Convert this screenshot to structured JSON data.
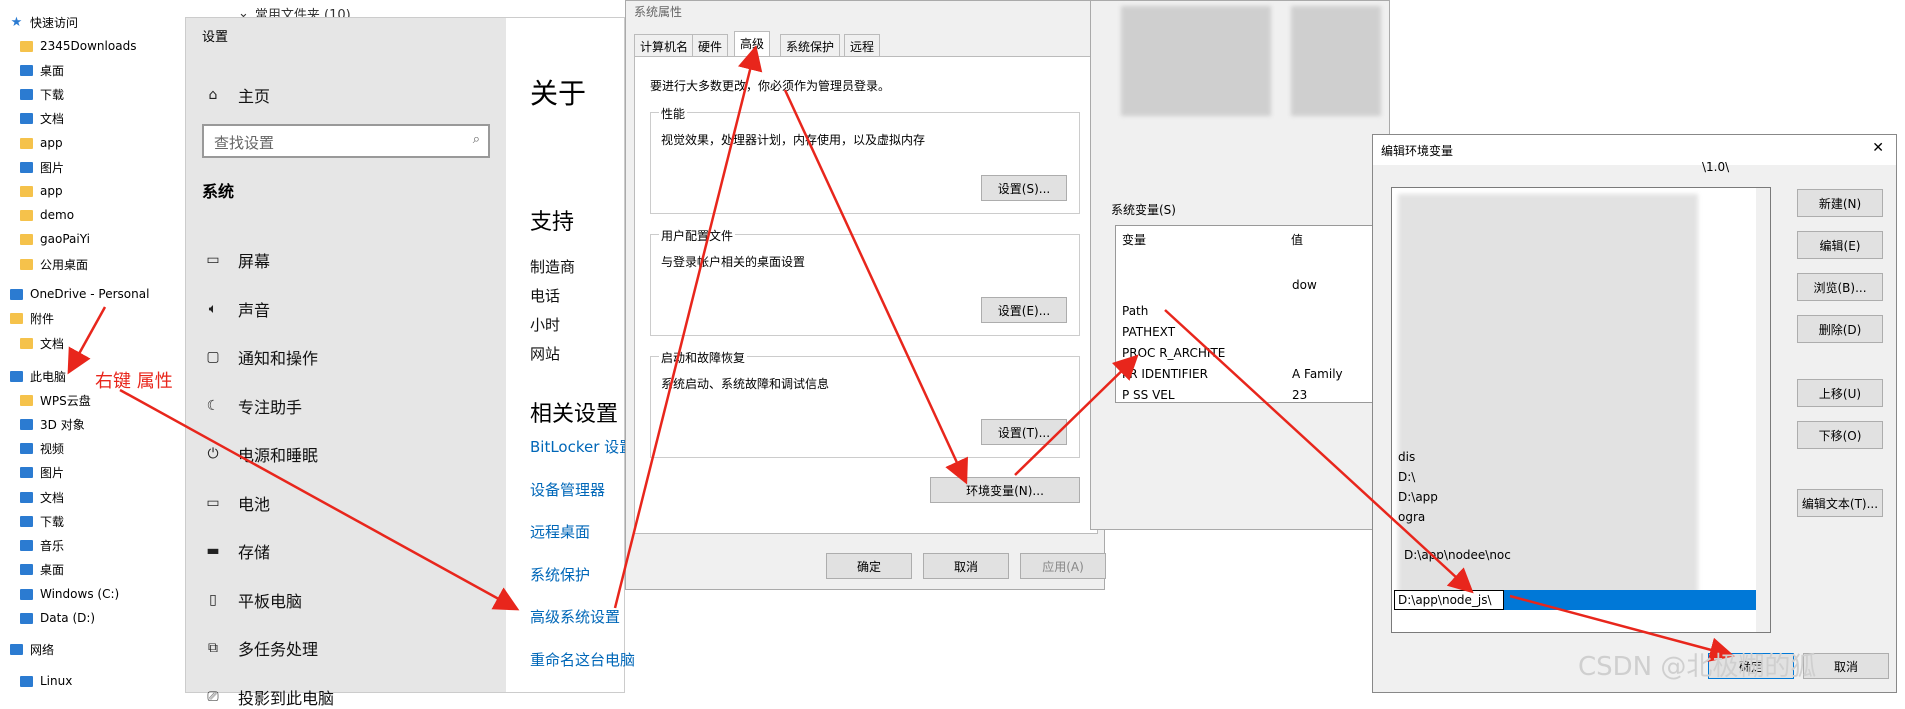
{
  "explorer": {
    "folder_header": "常用文件夹 (10)",
    "items": [
      {
        "label": "快速访问",
        "icon": "star-icon"
      },
      {
        "label": "2345Downloads",
        "icon": "folder-icon"
      },
      {
        "label": "桌面",
        "icon": "desktop-icon"
      },
      {
        "label": "下载",
        "icon": "download-icon"
      },
      {
        "label": "文档",
        "icon": "document-icon"
      },
      {
        "label": "app",
        "icon": "folder-icon"
      },
      {
        "label": "图片",
        "icon": "pictures-icon"
      },
      {
        "label": "app",
        "icon": "folder-icon"
      },
      {
        "label": "demo",
        "icon": "folder-icon"
      },
      {
        "label": "gaoPaiYi",
        "icon": "folder-icon"
      },
      {
        "label": "公用桌面",
        "icon": "folder-icon"
      },
      {
        "label": "OneDrive - Personal",
        "icon": "cloud-icon"
      },
      {
        "label": "附件",
        "icon": "folder-icon"
      },
      {
        "label": "文档",
        "icon": "folder-icon"
      },
      {
        "label": "此电脑",
        "icon": "computer-icon"
      },
      {
        "label": "WPS云盘",
        "icon": "folder-icon"
      },
      {
        "label": "3D 对象",
        "icon": "cube-icon"
      },
      {
        "label": "视频",
        "icon": "video-icon"
      },
      {
        "label": "图片",
        "icon": "pictures-icon"
      },
      {
        "label": "文档",
        "icon": "document-icon"
      },
      {
        "label": "下载",
        "icon": "download-icon"
      },
      {
        "label": "音乐",
        "icon": "music-icon"
      },
      {
        "label": "桌面",
        "icon": "desktop-icon"
      },
      {
        "label": "Windows (C:)",
        "icon": "drive-icon"
      },
      {
        "label": "Data (D:)",
        "icon": "drive-icon"
      },
      {
        "label": "网络",
        "icon": "network-icon"
      },
      {
        "label": "Linux",
        "icon": "linux-icon"
      }
    ],
    "annotation": "右键 属性"
  },
  "settings": {
    "title": "设置",
    "home": "主页",
    "search_placeholder": "查找设置",
    "section": "系统",
    "nav": [
      {
        "label": "屏幕",
        "icon": "display-icon"
      },
      {
        "label": "声音",
        "icon": "sound-icon"
      },
      {
        "label": "通知和操作",
        "icon": "notification-icon"
      },
      {
        "label": "专注助手",
        "icon": "moon-icon"
      },
      {
        "label": "电源和睡眠",
        "icon": "power-icon"
      },
      {
        "label": "电池",
        "icon": "battery-icon"
      },
      {
        "label": "存储",
        "icon": "storage-icon"
      },
      {
        "label": "平板电脑",
        "icon": "tablet-icon"
      },
      {
        "label": "多任务处理",
        "icon": "multitask-icon"
      },
      {
        "label": "投影到此电脑",
        "icon": "project-icon"
      }
    ],
    "page_title": "关于",
    "support_title": "支持",
    "support_items": [
      "制造商",
      "电话",
      "小时",
      "网站"
    ],
    "related_title": "相关设置",
    "related_links": [
      "BitLocker 设置",
      "设备管理器",
      "远程桌面",
      "系统保护",
      "高级系统设置",
      "重命名这台电脑"
    ]
  },
  "sysprops": {
    "title": "系统属性",
    "tabs": [
      "计算机名",
      "硬件",
      "高级",
      "系统保护",
      "远程"
    ],
    "admin_note": "要进行大多数更改，你必须作为管理员登录。",
    "perf_title": "性能",
    "perf_desc": "视觉效果，处理器计划，内存使用，以及虚拟内存",
    "perf_btn": "设置(S)...",
    "profile_title": "用户配置文件",
    "profile_desc": "与登录帐户相关的桌面设置",
    "profile_btn": "设置(E)...",
    "startup_title": "启动和故障恢复",
    "startup_desc": "系统启动、系统故障和调试信息",
    "startup_btn": "设置(T)...",
    "env_btn": "环境变量(N)...",
    "ok": "确定",
    "cancel": "取消",
    "apply": "应用(A)"
  },
  "envvars": {
    "sys_label": "系统变量(S)",
    "col_var": "变量",
    "col_val": "值",
    "rows": [
      {
        "name": "Path",
        "value": ""
      },
      {
        "name": "PATHEXT",
        "value": ""
      },
      {
        "name": "PROC   R_ARCHITE",
        "value": ""
      },
      {
        "name": "PR     IDENTIFIER",
        "value": "A       Family"
      },
      {
        "name": "P    SS   VEL",
        "value": "23"
      }
    ],
    "partial_value": "dow"
  },
  "editenv": {
    "title": "编辑环境变量",
    "close": "✕",
    "buttons": [
      "新建(N)",
      "编辑(E)",
      "浏览(B)...",
      "删除(D)",
      "上移(U)",
      "下移(O)",
      "编辑文本(T)..."
    ],
    "entries": [
      "\\1.0\\",
      "dis",
      "D:\\",
      "D:\\app",
      "ogra",
      "D:\\app\\nodee\\noc"
    ],
    "editing_value": "D:\\app\\node_js\\",
    "ok": "确定",
    "cancel": "取消"
  },
  "watermark": "CSDN @北极糊的狐"
}
